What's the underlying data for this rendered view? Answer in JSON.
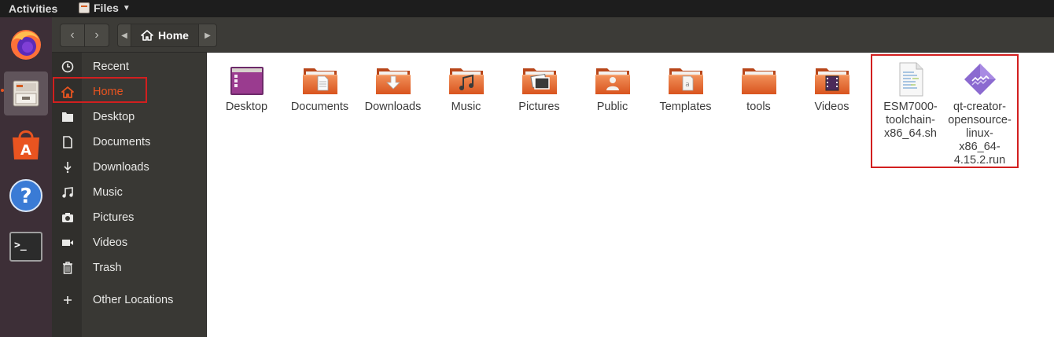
{
  "topbar": {
    "activities": "Activities",
    "app_name": "Files"
  },
  "dock": {
    "items": [
      {
        "name": "Firefox",
        "icon": "firefox-icon"
      },
      {
        "name": "Files",
        "icon": "files-icon",
        "active": true
      },
      {
        "name": "Ubuntu Software",
        "icon": "software-icon"
      },
      {
        "name": "Help",
        "icon": "help-icon"
      },
      {
        "name": "Terminal",
        "icon": "terminal-icon"
      }
    ]
  },
  "headerbar": {
    "location": "Home"
  },
  "sidebar": {
    "items": [
      {
        "label": "Recent",
        "icon": "clock-icon"
      },
      {
        "label": "Home",
        "icon": "home-icon",
        "selected": true
      },
      {
        "label": "Desktop",
        "icon": "folder-icon"
      },
      {
        "label": "Documents",
        "icon": "document-icon"
      },
      {
        "label": "Downloads",
        "icon": "download-icon"
      },
      {
        "label": "Music",
        "icon": "music-icon"
      },
      {
        "label": "Pictures",
        "icon": "camera-icon"
      },
      {
        "label": "Videos",
        "icon": "video-icon"
      },
      {
        "label": "Trash",
        "icon": "trash-icon"
      },
      {
        "label": "Other Locations",
        "icon": "plus-icon"
      }
    ]
  },
  "content": {
    "files": [
      {
        "label": "Desktop",
        "kind": "desktop-folder"
      },
      {
        "label": "Documents",
        "kind": "documents-folder"
      },
      {
        "label": "Downloads",
        "kind": "downloads-folder"
      },
      {
        "label": "Music",
        "kind": "music-folder"
      },
      {
        "label": "Pictures",
        "kind": "pictures-folder"
      },
      {
        "label": "Public",
        "kind": "public-folder"
      },
      {
        "label": "Templates",
        "kind": "templates-folder"
      },
      {
        "label": "tools",
        "kind": "folder"
      },
      {
        "label": "Videos",
        "kind": "videos-folder"
      },
      {
        "label": "ESM7000-toolchain-x86_64.sh",
        "kind": "script-file"
      },
      {
        "label": "qt-creator-opensource-linux-x86_64-4.15.2.run",
        "kind": "run-file"
      }
    ]
  },
  "colors": {
    "accent": "#e95420",
    "highlight_box": "#d21f1f",
    "sidebar_bg": "#393834",
    "dock_bg": "#3d2f37"
  }
}
